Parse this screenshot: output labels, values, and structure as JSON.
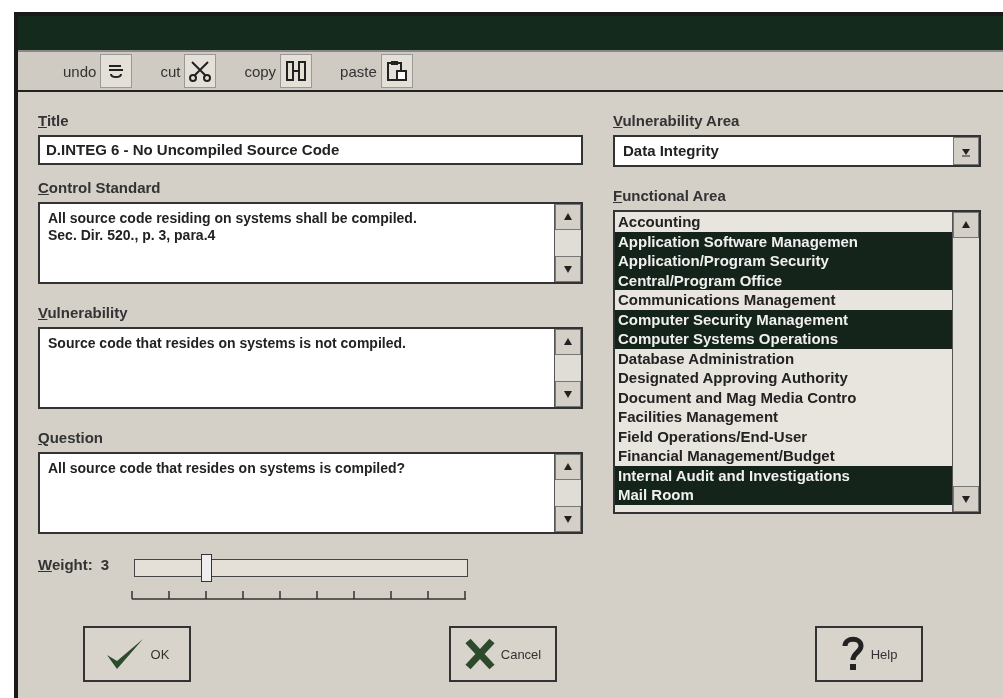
{
  "toolbar": [
    {
      "label": "undo",
      "kind": "undo"
    },
    {
      "label": "cut",
      "kind": "cut"
    },
    {
      "label": "copy",
      "kind": "copy"
    },
    {
      "label": "paste",
      "kind": "paste"
    }
  ],
  "title": {
    "label": "Title",
    "value": "D.INTEG 6 - No Uncompiled Source Code"
  },
  "text_fields": [
    {
      "label": "Control Standard",
      "value": "All source code residing on systems shall be compiled.   Sec. Dir. 520., p. 3, para.4"
    },
    {
      "label": "Vulnerability",
      "value": "Source code that resides  on systems is not compiled."
    },
    {
      "label": "Question",
      "value": "All source code that resides on systems is compiled?"
    }
  ],
  "vulnerability_area": {
    "label": "Vulnerability Area",
    "value": "Data Integrity"
  },
  "functional_area": {
    "label": "Functional Area",
    "items": [
      {
        "label": "Accounting",
        "selected": false
      },
      {
        "label": "Application Software Managemen",
        "selected": true
      },
      {
        "label": "Application/Program Security",
        "selected": true
      },
      {
        "label": "Central/Program Office",
        "selected": true
      },
      {
        "label": "Communications Management",
        "selected": false
      },
      {
        "label": "Computer Security Management",
        "selected": true
      },
      {
        "label": "Computer Systems Operations",
        "selected": true
      },
      {
        "label": "Database Administration",
        "selected": false
      },
      {
        "label": "Designated Approving Authority",
        "selected": false
      },
      {
        "label": "Document and Mag Media Contro",
        "selected": false
      },
      {
        "label": "Facilities Management",
        "selected": false
      },
      {
        "label": "Field Operations/End-User",
        "selected": false
      },
      {
        "label": "Financial Management/Budget",
        "selected": false
      },
      {
        "label": "Internal Audit and Investigations",
        "selected": true
      },
      {
        "label": "Mail Room",
        "selected": true
      }
    ]
  },
  "weight": {
    "label": "Weight:",
    "value": "3",
    "level": 0.21
  },
  "buttons": [
    {
      "label": "OK",
      "kind": "ok"
    },
    {
      "label": "Cancel",
      "kind": "cancel"
    },
    {
      "label": "Help",
      "kind": "help"
    }
  ]
}
